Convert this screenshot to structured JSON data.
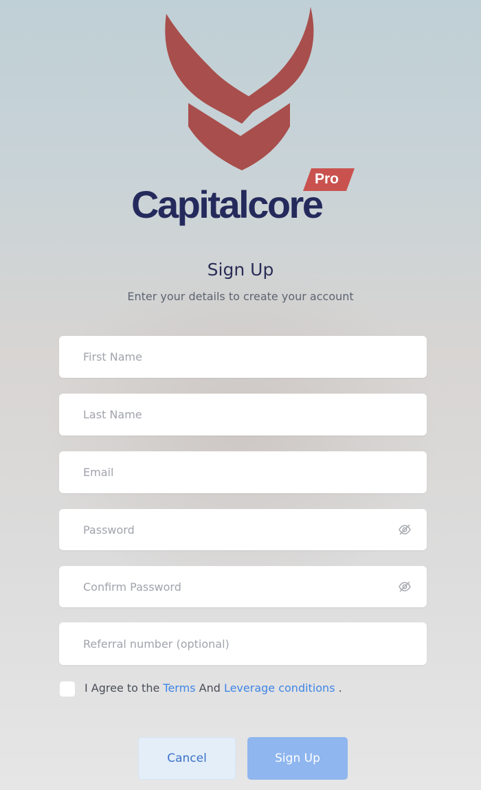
{
  "brand": {
    "name": "Capitalcore",
    "badge": "Pro",
    "colors": {
      "mark": "#a84e4c",
      "name": "#252a5c",
      "badge": "#c9524f"
    }
  },
  "header": {
    "title": "Sign Up",
    "subtitle": "Enter your details to create your account"
  },
  "form": {
    "first_name": {
      "value": "",
      "placeholder": "First Name"
    },
    "last_name": {
      "value": "",
      "placeholder": "Last Name"
    },
    "email": {
      "value": "",
      "placeholder": "Email"
    },
    "password": {
      "value": "",
      "placeholder": "Password",
      "icon": "eye-slash-icon"
    },
    "confirm_password": {
      "value": "",
      "placeholder": "Confirm Password",
      "icon": "eye-slash-icon"
    },
    "referral": {
      "value": "",
      "placeholder": "Referral number (optional)"
    }
  },
  "agreement": {
    "checked": false,
    "prefix": "I Agree to the ",
    "terms_link": "Terms",
    "middle": " And ",
    "leverage_link": "Leverage conditions",
    "suffix": " ."
  },
  "actions": {
    "cancel_label": "Cancel",
    "signup_label": "Sign Up"
  },
  "colors": {
    "link": "#3f85e6",
    "signup_button": "#8fb6ef",
    "cancel_button": "#e3eef9"
  }
}
